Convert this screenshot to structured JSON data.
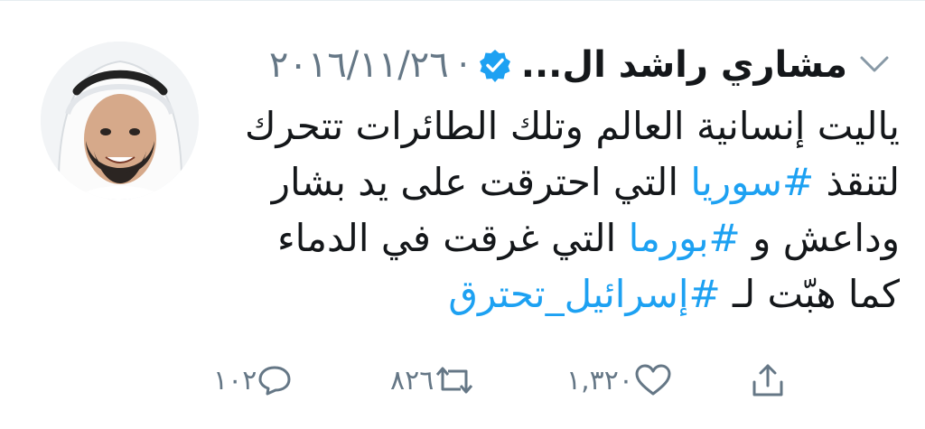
{
  "tweet": {
    "author_name": "مشاري راشد ال...",
    "separator": "·",
    "date": "٢٠١٦/١١/٢٦",
    "text": {
      "line1": "ياليت إنسانية العالم وتلك الطائرات تتحرك",
      "line2_prefix": "لتنقذ ",
      "line2_tag": "#سوريا",
      "line2_suffix": " التي احترقت على يد بشار",
      "line3_prefix": "وداعش و ",
      "line3_tag": "#بورما",
      "line3_suffix": " التي غرقت في الدماء",
      "line4_prefix": "كما هبّت لـ ",
      "line4_tag": "#إسرائيل_تحترق"
    },
    "actions": {
      "replies": "١٠٢",
      "retweets": "٨٢٦",
      "likes": "١,٣٢٠"
    }
  },
  "icons": {
    "verified": "verified-badge-icon",
    "chevron": "chevron-down-icon",
    "reply": "reply-icon",
    "retweet": "retweet-icon",
    "like": "heart-icon",
    "share": "share-icon"
  },
  "colors": {
    "text": "#14171a",
    "secondary": "#657786",
    "link": "#1da1f2",
    "verified": "#1da1f2"
  }
}
